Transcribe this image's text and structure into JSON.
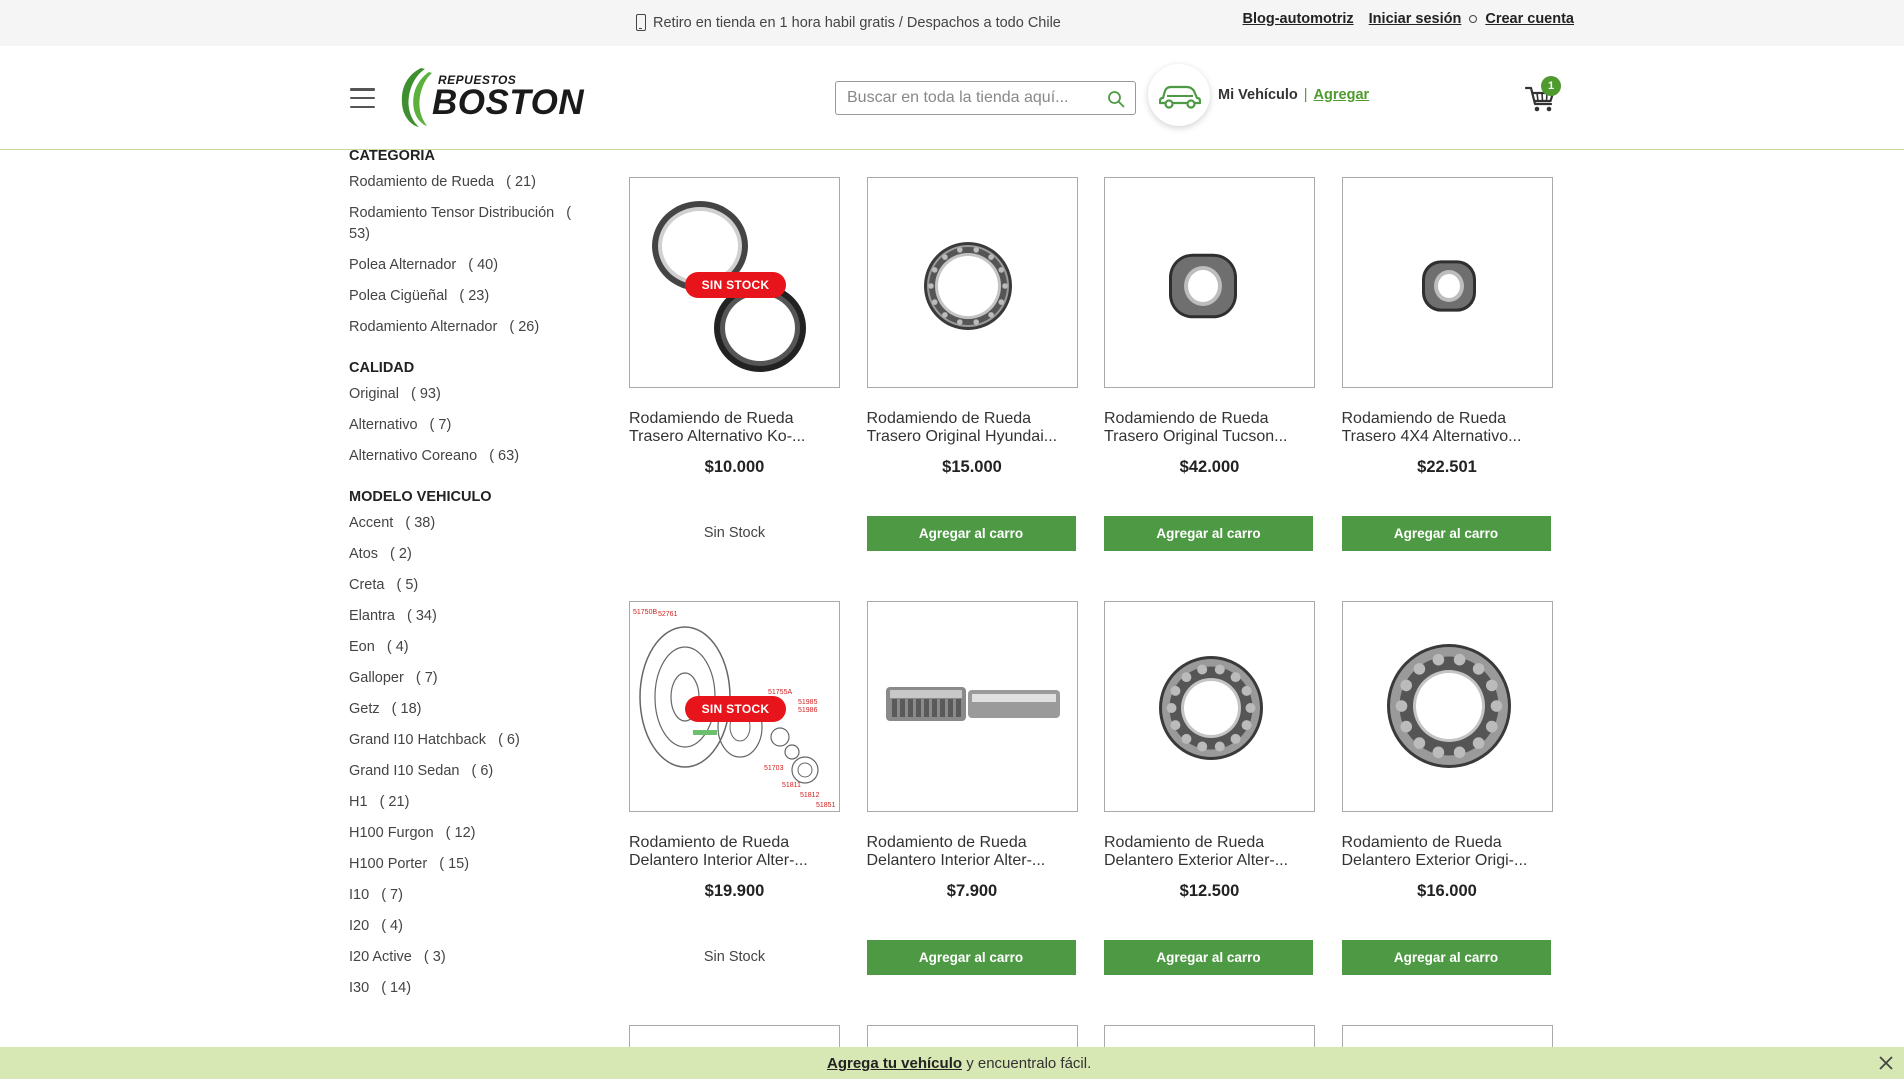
{
  "topbar": {
    "promo": "Retiro en tienda en 1 hora habil gratis / Despachos a todo Chile",
    "links": {
      "blog": "Blog-automotriz",
      "login": "Iniciar sesión",
      "register": "Crear cuenta"
    }
  },
  "header": {
    "logo_top": "REPUESTOS",
    "logo_main": "BOSTON",
    "search_placeholder": "Buscar en toda la tienda aquí...",
    "vehicle_label": "Mi Vehículo",
    "vehicle_sep": "|",
    "vehicle_add": "Agregar",
    "cart_count": "1"
  },
  "sidebar": {
    "categoria": {
      "title": "CATEGORIA",
      "items": [
        {
          "label": "Rodamiento de Rueda",
          "count": "( 21)"
        },
        {
          "label": "Rodamiento Tensor Distribución",
          "count": "( 53)"
        },
        {
          "label": "Polea Alternador",
          "count": "( 40)"
        },
        {
          "label": "Polea Cigüeñal",
          "count": "( 23)"
        },
        {
          "label": "Rodamiento Alternador",
          "count": "( 26)"
        }
      ]
    },
    "calidad": {
      "title": "CALIDAD",
      "items": [
        {
          "label": "Original",
          "count": "( 93)"
        },
        {
          "label": "Alternativo",
          "count": "( 7)"
        },
        {
          "label": "Alternativo Coreano",
          "count": "( 63)"
        }
      ]
    },
    "modelo": {
      "title": "MODELO VEHICULO",
      "items": [
        {
          "label": "Accent",
          "count": "( 38)"
        },
        {
          "label": "Atos",
          "count": "( 2)"
        },
        {
          "label": "Creta",
          "count": "( 5)"
        },
        {
          "label": "Elantra",
          "count": "( 34)"
        },
        {
          "label": "Eon",
          "count": "( 4)"
        },
        {
          "label": "Galloper",
          "count": "( 7)"
        },
        {
          "label": "Getz",
          "count": "( 18)"
        },
        {
          "label": "Grand I10 Hatchback",
          "count": "( 6)"
        },
        {
          "label": "Grand I10 Sedan",
          "count": "( 6)"
        },
        {
          "label": "H1",
          "count": "( 21)"
        },
        {
          "label": "H100 Furgon",
          "count": "( 12)"
        },
        {
          "label": "H100 Porter",
          "count": "( 15)"
        },
        {
          "label": "I10",
          "count": "( 7)"
        },
        {
          "label": "I20",
          "count": "( 4)"
        },
        {
          "label": "I20 Active",
          "count": "( 3)"
        },
        {
          "label": "I30",
          "count": "( 14)"
        }
      ]
    }
  },
  "products": [
    {
      "name": "Rodamiendo de Rueda Trasero Alternativo Ko-...",
      "price": "$10.000",
      "in_stock": false,
      "badge": "SIN STOCK",
      "status": "Sin Stock"
    },
    {
      "name": "Rodamiendo de Rueda Trasero Original Hyundai...",
      "price": "$15.000",
      "in_stock": true,
      "button": "Agregar al carro"
    },
    {
      "name": "Rodamiendo de Rueda Trasero Original Tucson...",
      "price": "$42.000",
      "in_stock": true,
      "button": "Agregar al carro"
    },
    {
      "name": "Rodamiendo de Rueda Trasero 4X4 Alternativo...",
      "price": "$22.501",
      "in_stock": true,
      "button": "Agregar al carro"
    },
    {
      "name": "Rodamiento de Rueda Delantero Interior Alter-...",
      "price": "$19.900",
      "in_stock": false,
      "badge": "SIN STOCK",
      "status": "Sin Stock"
    },
    {
      "name": "Rodamiento de Rueda Delantero Interior Alter-...",
      "price": "$7.900",
      "in_stock": true,
      "button": "Agregar al carro"
    },
    {
      "name": "Rodamiento de Rueda Delantero Exterior Alter-...",
      "price": "$12.500",
      "in_stock": true,
      "button": "Agregar al carro"
    },
    {
      "name": "Rodamiento de Rueda Delantero Exterior Origi-...",
      "price": "$16.000",
      "in_stock": true,
      "button": "Agregar al carro"
    }
  ],
  "diagram_labels": [
    "51750B",
    "52761",
    "51755A",
    "51985",
    "51986",
    "51703",
    "51811",
    "51812",
    "51851"
  ],
  "banner": {
    "link": "Agrega tu vehículo",
    "text": " y encuentralo fácil."
  },
  "colors": {
    "brand_green": "#4e9a44",
    "badge_red": "#e8141b",
    "banner_bg": "#d8e8b4"
  }
}
